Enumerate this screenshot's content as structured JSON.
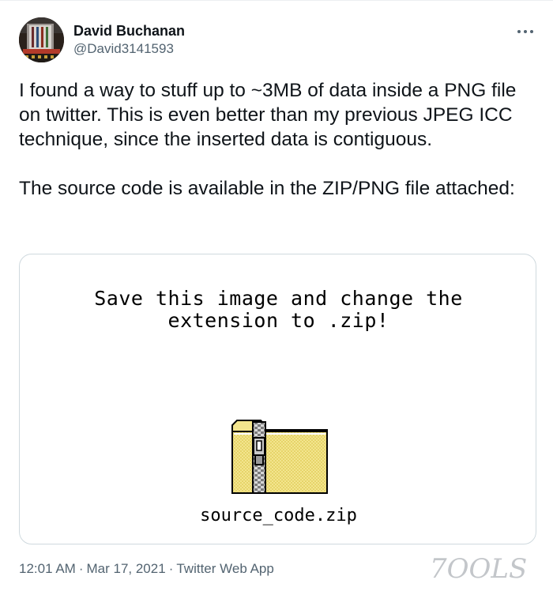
{
  "tweet": {
    "author": {
      "name": "David Buchanan",
      "handle": "@David3141593"
    },
    "more_label": "···",
    "text_paragraphs": [
      "I found a way to stuff up to ~3MB of data inside a PNG file on twitter. This is even better than my previous JPEG ICC technique, since the inserted data is contiguous.",
      "The source code is available in the ZIP/PNG file attached:"
    ],
    "media": {
      "headline_line1": "Save this image and change the",
      "headline_line2": "extension to .zip!",
      "icon": "zip-folder-icon",
      "filename": "source_code.zip"
    },
    "meta": {
      "time": "12:01 AM",
      "separator": "·",
      "date": "Mar 17, 2021",
      "source": "Twitter Web App"
    }
  },
  "watermark": {
    "text": "7OOLS"
  },
  "colors": {
    "text_primary": "#0f1419",
    "text_secondary": "#536471",
    "card_border": "#cfd9de",
    "folder_yellow": "#f3e58e"
  }
}
